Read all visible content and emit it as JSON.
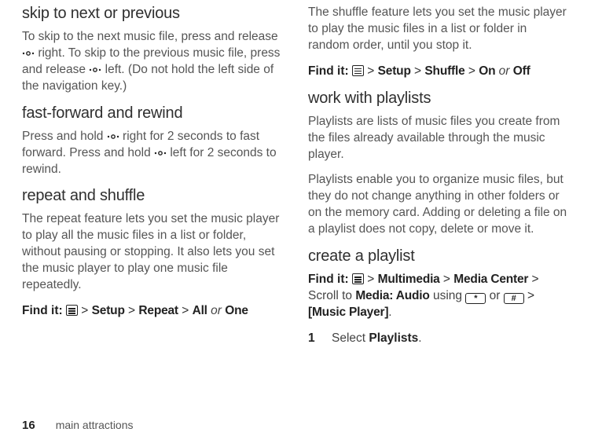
{
  "left": {
    "h_skip": "skip to next or previous",
    "p_skip": {
      "pre": "To skip to the next music file, press and release ",
      "mid": " right. To skip to the previous music file, press and release ",
      "post": " left. (Do not hold the left side of the navigation key.)"
    },
    "h_ff": "fast-forward and rewind",
    "p_ff": {
      "pre": "Press and hold ",
      "mid": " right for 2 seconds to fast forward. Press and hold ",
      "post": " left for 2 seconds to rewind."
    },
    "h_rs": "repeat and shuffle",
    "p_rs": "The repeat feature lets you set the music player to play all the music files in a list or folder, without pausing or stopping. It also lets you set the music player to play one music file repeatedly.",
    "find_repeat": {
      "label": "Find it:",
      "a": "Setup",
      "b": "Repeat",
      "c": "All",
      "or": "or",
      "d": "One"
    }
  },
  "right": {
    "p_shuffle": "The shuffle feature lets you set the music player to play the music files in a list or folder in random order, until you stop it.",
    "find_shuffle": {
      "label": "Find it:",
      "a": "Setup",
      "b": "Shuffle",
      "c": "On",
      "or": "or",
      "d": "Off"
    },
    "h_pl": "work with playlists",
    "p_pl": "Playlists are lists of music files you create from the files already available through the music player.",
    "p_pl2": "Playlists enable you to organize music files, but they do not change anything in other folders or on the memory card. Adding or deleting a file on  a playlist does not copy, delete or move it.",
    "h_create": "create a playlist",
    "find_create": {
      "label": "Find it:",
      "a": "Multimedia",
      "b": "Media Center",
      "scroll_pre": "Scroll to ",
      "c": "Media: Audio",
      "using": " using ",
      "or": "  or  ",
      "d": "[Music Player]"
    },
    "step1": {
      "num": "1",
      "pre": "Select ",
      "bold": "Playlists",
      "post": "."
    }
  },
  "glyph": {
    "gt": ">",
    "star": "*",
    "hash": "#"
  },
  "footer": {
    "page": "16",
    "section": "main attractions"
  }
}
